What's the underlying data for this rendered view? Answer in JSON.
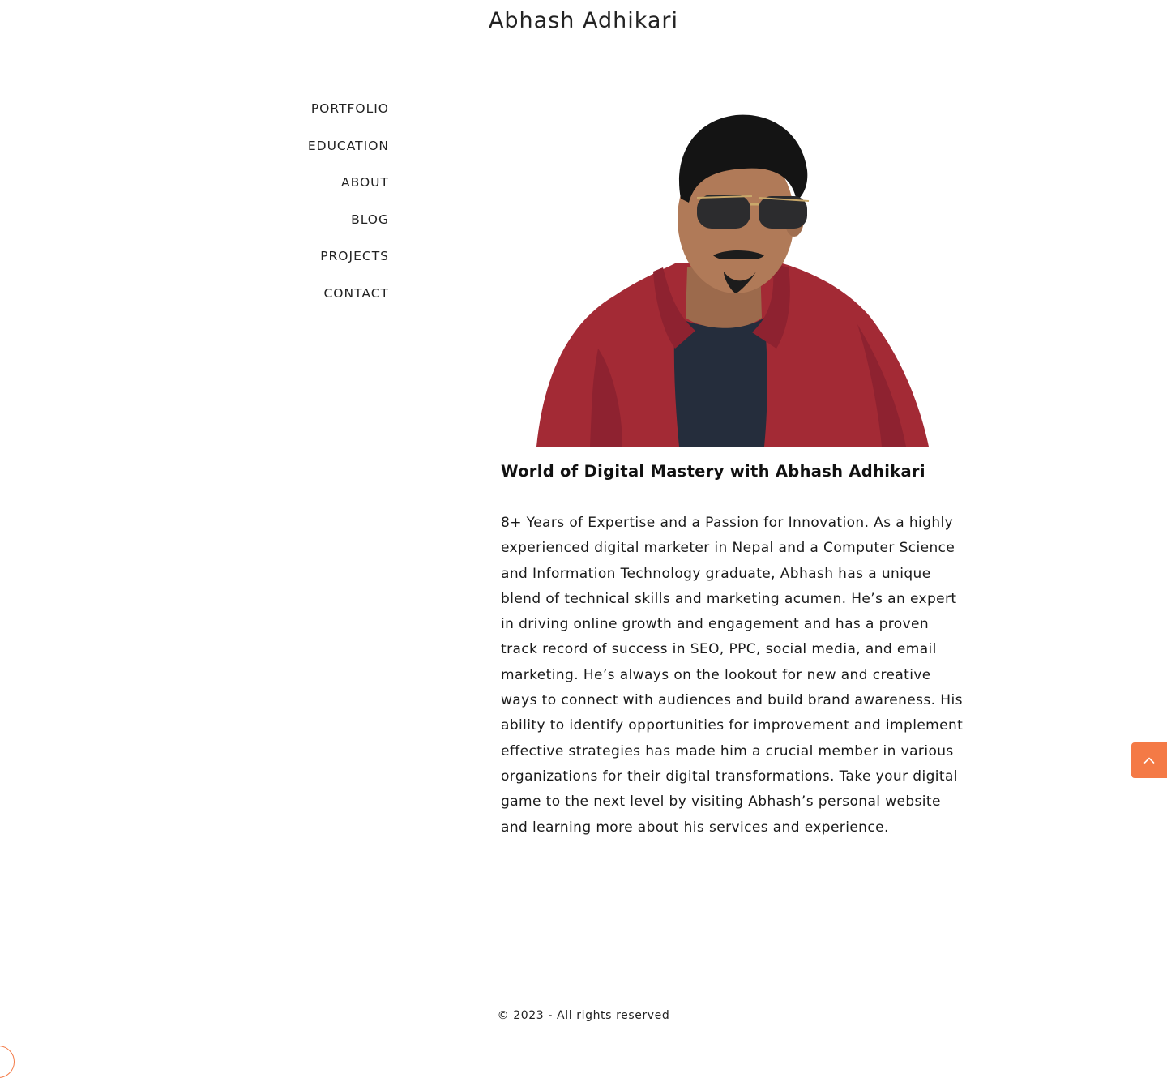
{
  "header": {
    "site_title": "Abhash Adhikari"
  },
  "nav": {
    "items": [
      {
        "label": "PORTFOLIO"
      },
      {
        "label": "EDUCATION"
      },
      {
        "label": "ABOUT"
      },
      {
        "label": "BLOG"
      },
      {
        "label": "PROJECTS"
      },
      {
        "label": "CONTACT"
      }
    ]
  },
  "main": {
    "headline": "World of Digital Mastery with Abhash Adhikari",
    "bio": " 8+ Years of Expertise and a Passion for Innovation. As a highly experienced digital marketer in Nepal and a Computer Science and Information Technology graduate, Abhash has a unique blend of technical skills and marketing acumen. He’s an expert in driving online growth and engagement and has a proven track record of success in SEO, PPC, social media, and email marketing. He’s always on the lookout for new and creative ways to connect with audiences and build brand awareness. His ability to identify opportunities for improvement and implement effective strategies has made him a crucial member in various organizations for their digital transformations. Take your digital game to the next level by visiting Abhash’s personal website and learning more about his services and experience."
  },
  "footer": {
    "text": "© 2023 - All rights reserved"
  },
  "colors": {
    "accent": "#f47a46",
    "jacket": "#a32a35",
    "shirt": "#252d3c",
    "skin": "#b07a58",
    "hair": "#141414"
  },
  "icons": {
    "back_to_top": "chevron-up-icon",
    "corner_widget": "circle-arc-icon"
  }
}
